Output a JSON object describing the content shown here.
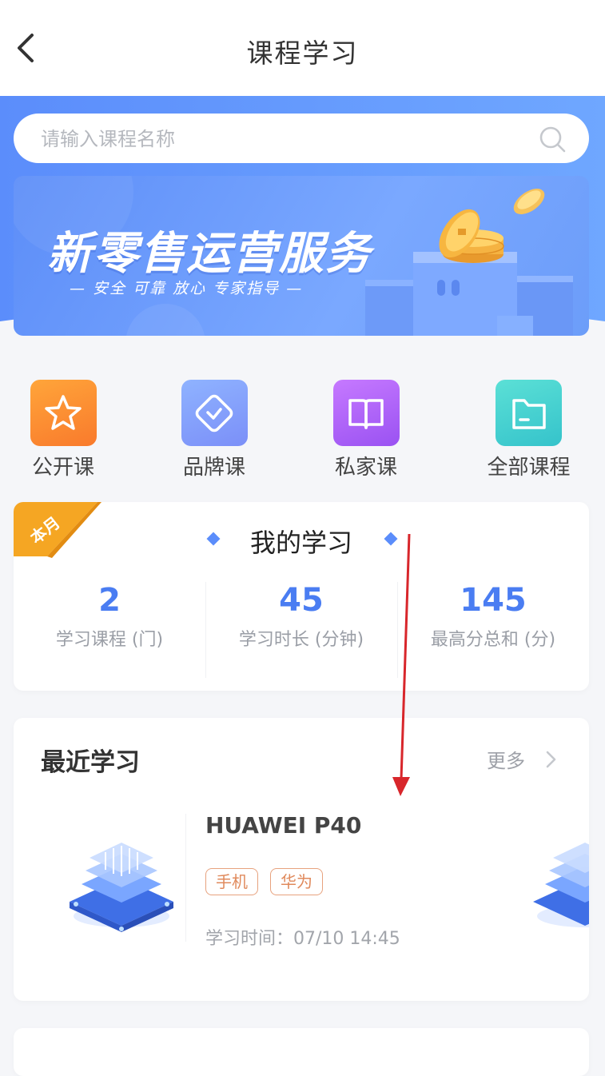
{
  "header": {
    "title": "课程学习",
    "back_icon": "chevron-left-icon"
  },
  "search": {
    "placeholder": "请输入课程名称",
    "icon": "search-icon"
  },
  "banner": {
    "title": "新零售运营服务",
    "subtitle": "— 安全 可靠 放心 专家指导 —"
  },
  "categories": [
    {
      "label": "公开课",
      "icon": "star-icon",
      "color": "#f97a2c"
    },
    {
      "label": "品牌课",
      "icon": "badge-check-icon",
      "color": "#7d9bfa"
    },
    {
      "label": "私家课",
      "icon": "book-icon",
      "color": "#a85cf5"
    },
    {
      "label": "全部课程",
      "icon": "folder-icon",
      "color": "#3dcfc9"
    }
  ],
  "my_study": {
    "badge": "本月",
    "title": "我的学习",
    "stats": [
      {
        "value": "2",
        "label": "学习课程 (门)"
      },
      {
        "value": "45",
        "label": "学习时长 (分钟)"
      },
      {
        "value": "145",
        "label": "最高分总和 (分)"
      }
    ]
  },
  "recent": {
    "title": "最近学习",
    "more_label": "更多",
    "course": {
      "name": "HUAWEI P40",
      "tags": [
        "手机",
        "华为"
      ],
      "time": "学习时间：07/10 14:45"
    }
  },
  "colors": {
    "primary": "#5b8dfb",
    "accent_orange": "#f5a623",
    "annotation_arrow": "#d8262b"
  }
}
